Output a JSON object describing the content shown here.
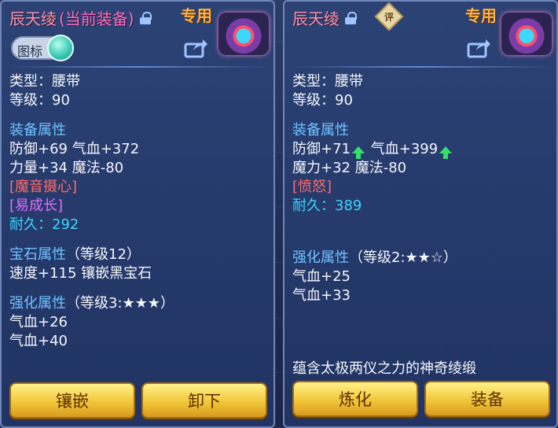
{
  "left_panel": {
    "title": "辰天绫",
    "equipped_tag": "(当前装备)",
    "exclusive": "专用",
    "icon_toggle_label": "图标",
    "type_line": "类型：腰带",
    "level_line": "等级：90",
    "equip_attr_header": "装备属性",
    "attr_line1": "防御+69 气血+372",
    "attr_line2": "力量+34 魔法-80",
    "special1": "[魔音摄心]",
    "special2": "[易成长]",
    "durability_label": "耐久：",
    "durability_value": "292",
    "gem_header": "宝石属性",
    "gem_level": "（等级12）",
    "gem_line": "速度+115 镶嵌黑宝石",
    "enhance_header": "强化属性",
    "enhance_level": "（等级3:★★★）",
    "enhance_line1": "气血+26",
    "enhance_line2": "气血+40",
    "buttons": {
      "inlay": "镶嵌",
      "unequip": "卸下"
    }
  },
  "right_panel": {
    "title": "辰天绫",
    "rate_badge": "评",
    "exclusive": "专用",
    "type_line": "类型：腰带",
    "level_line": "等级：90",
    "equip_attr_header": "装备属性",
    "attr_line1_a": "防御+71",
    "attr_line1_b": "气血+399",
    "attr_line2": "魔力+32 魔法-80",
    "special1": "[愤怒]",
    "durability_label": "耐久：",
    "durability_value": "389",
    "enhance_header": "强化属性",
    "enhance_level": "（等级2:★★☆）",
    "enhance_line1": "气血+25",
    "enhance_line2": "气血+33",
    "description": "蕴含太极两仪之力的神奇绫缎",
    "buttons": {
      "refine": "炼化",
      "equip": "装备"
    }
  },
  "colors": {
    "section_header": "#6fc2ff",
    "special_red": "#ff6a6a",
    "special_purple": "#e16cff",
    "durability": "#38d6ff",
    "upgrade_arrow": "#35e06a",
    "button_gold": "#f2c63a"
  }
}
